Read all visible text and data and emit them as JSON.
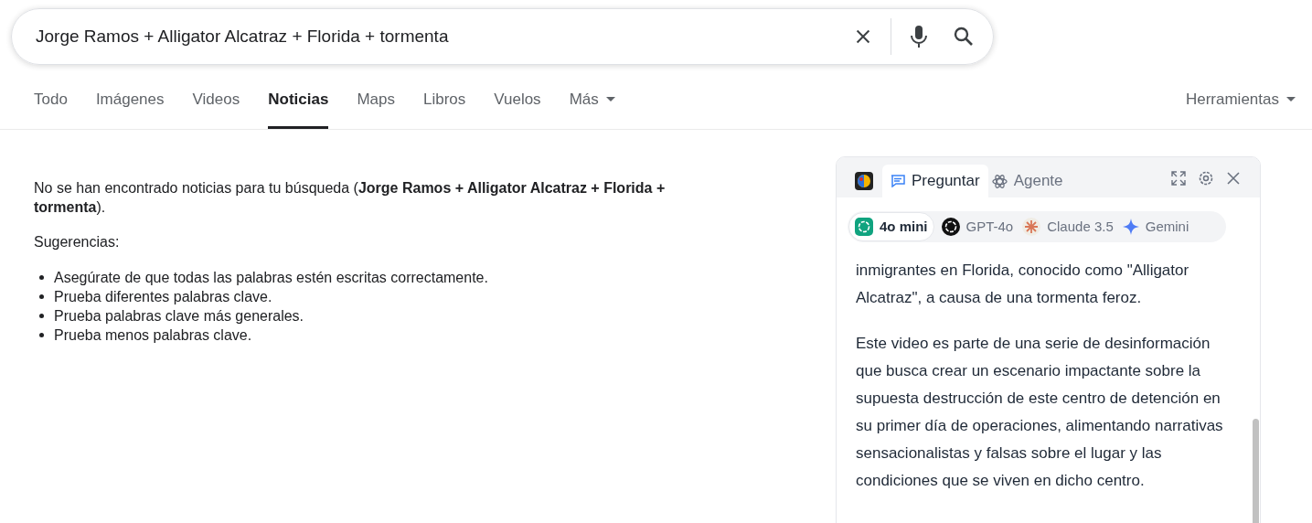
{
  "search": {
    "value": "Jorge Ramos + Alligator Alcatraz + Florida + tormenta"
  },
  "tabs": [
    {
      "label": "Todo",
      "selected": false
    },
    {
      "label": "Imágenes",
      "selected": false
    },
    {
      "label": "Videos",
      "selected": false
    },
    {
      "label": "Noticias",
      "selected": true
    },
    {
      "label": "Maps",
      "selected": false
    },
    {
      "label": "Libros",
      "selected": false
    },
    {
      "label": "Vuelos",
      "selected": false
    },
    {
      "label": "Más",
      "selected": false,
      "kind": "menu"
    }
  ],
  "tools": "Herramientas",
  "results": {
    "message": "No se han encontrado noticias para tu búsqueda (**Jorge Ramos + Alligator Alcatraz + Florida + tormenta**).",
    "suggestions_title": "Sugerencias:",
    "suggestions": [
      "Asegúrate de que todas las palabras estén escritas correctamente.",
      "Prueba diferentes palabras clave.",
      "Prueba palabras clave más generales.",
      "Prueba menos palabras clave."
    ]
  },
  "assistant": {
    "tabs": [
      {
        "label": "Preguntar",
        "selected": true,
        "kind": "chat"
      },
      {
        "label": "Agente",
        "selected": false,
        "kind": "agent"
      }
    ],
    "models": [
      {
        "label": "4o mini",
        "selected": true,
        "kind": "gpt-green"
      },
      {
        "label": "GPT-4o",
        "selected": false,
        "kind": "gpt-black"
      },
      {
        "label": "Claude 3.5",
        "selected": false,
        "kind": "claude"
      },
      {
        "label": "Gemini",
        "selected": false,
        "kind": "gemini"
      }
    ],
    "paragraphs": [
      "inmigrantes en Florida, conocido como \"Alligator Alcatraz\", a causa de una tormenta feroz.",
      "Este video es parte de una serie de desinformación que busca crear un escenario impactante sobre la supuesta destrucción de este centro de detención en su primer día de operaciones, alimentando narrativas sensacionalistas y falsas sobre el lugar y las condiciones que se viven en dicho centro."
    ]
  }
}
